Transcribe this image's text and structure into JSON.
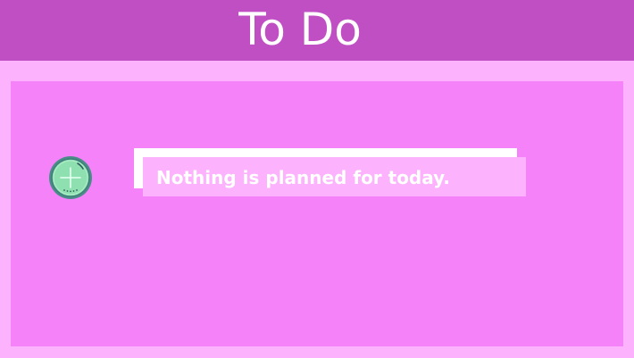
{
  "app": {
    "title": "To Do"
  },
  "empty_state": {
    "message": "Nothing is planned for today."
  },
  "add_button": {
    "icon": "plus-circle-icon"
  },
  "colors": {
    "header": "#bf4fc3",
    "background": "#fdb2fd",
    "panel": "#f582f9",
    "card": "#fdb2fd",
    "card_shadow": "#ffffff",
    "text": "#ffffff",
    "button_fill": "#8fe0b1",
    "button_ring": "#4a8c88"
  }
}
